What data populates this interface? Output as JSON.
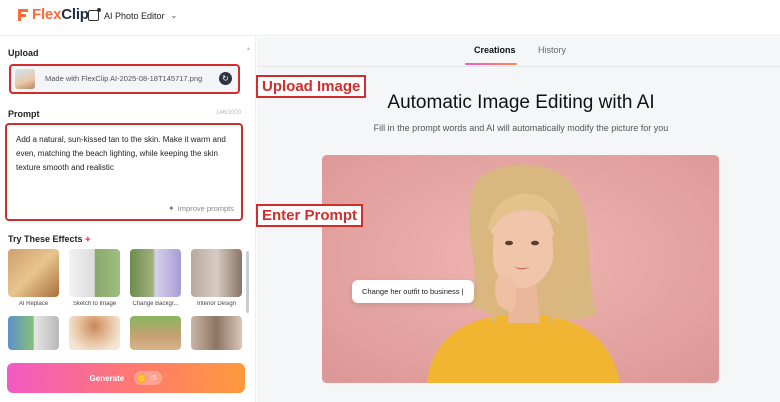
{
  "header": {
    "logo_text_a": "Flex",
    "logo_text_b": "Clip",
    "editor_label": "AI Photo Editor"
  },
  "left": {
    "upload_title": "Upload",
    "upload_filename": "Made with FlexClip AI-2025-08-18T145717.png",
    "prompt_title": "Prompt",
    "prompt_counter": "146/1000",
    "prompt_text": "Add a natural, sun-kissed tan to the skin. Make it warm and even, matching the beach lighting, while keeping the skin texture smooth and realistic",
    "improve_label": "Improve prompts",
    "effects_title": "Try These Effects",
    "effects": [
      {
        "label": "AI Replace"
      },
      {
        "label": "Sketch to Image"
      },
      {
        "label": "Change Backgr..."
      },
      {
        "label": "Interior Design"
      },
      {
        "label": ""
      },
      {
        "label": ""
      },
      {
        "label": ""
      },
      {
        "label": ""
      }
    ],
    "generate_label": "Generate",
    "generate_cost": "-5"
  },
  "right": {
    "tabs": [
      {
        "label": "Creations",
        "active": true
      },
      {
        "label": "History",
        "active": false
      }
    ],
    "headline": "Automatic Image Editing with AI",
    "subline": "Fill in the prompt words and AI will automatically modify the picture for you",
    "chat_bubble": "Change her outfit to business |"
  },
  "annotations": {
    "upload": "Upload Image",
    "prompt": "Enter Prompt"
  },
  "colors": {
    "accent_red": "#d22c2c",
    "brand_orange": "#ff6a3d",
    "generate_start": "#f15ac4",
    "generate_end": "#ff9a3d"
  }
}
